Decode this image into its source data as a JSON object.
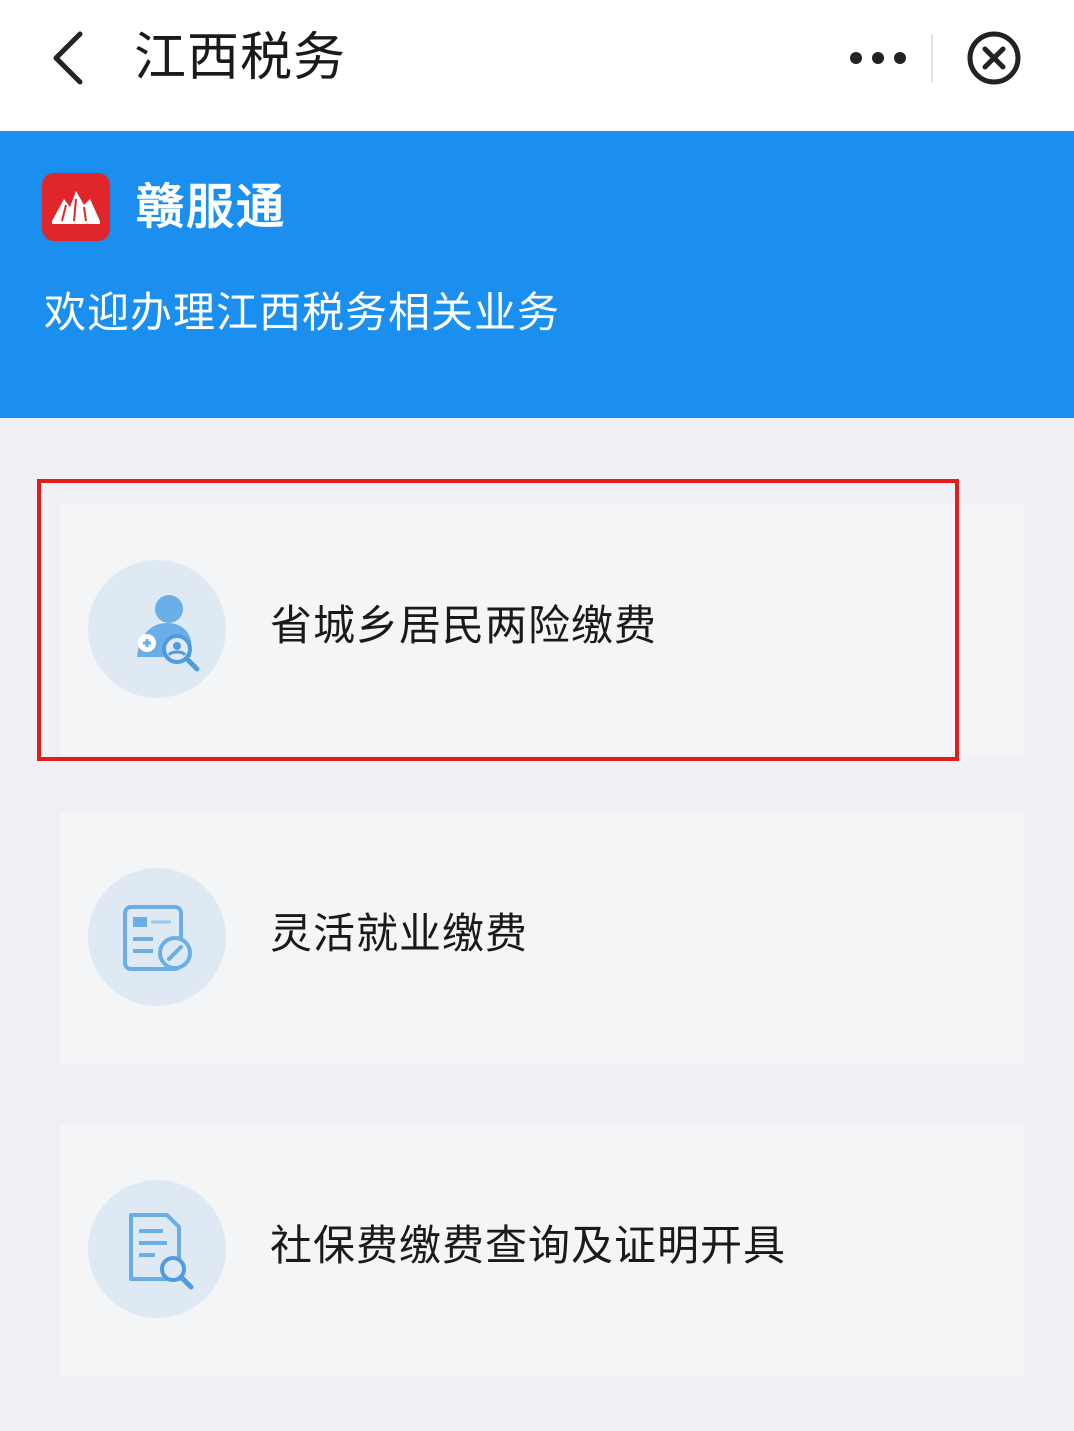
{
  "header": {
    "title": "江西税务",
    "back_icon": "chevron-left-icon",
    "more_icon": "more-dots-icon",
    "close_icon": "close-circle-icon"
  },
  "banner": {
    "brand": "赣服通",
    "welcome": "欢迎办理江西税务相关业务",
    "background_color": "#1b8ff0",
    "logo_color": "#e0262a"
  },
  "services": [
    {
      "label": "省城乡居民两险缴费",
      "icon": "resident-insurance-icon",
      "highlighted": true
    },
    {
      "label": "灵活就业缴费",
      "icon": "payment-form-icon",
      "highlighted": false
    },
    {
      "label": "社保费缴费查询及证明开具",
      "icon": "document-search-icon",
      "highlighted": false
    }
  ],
  "highlight_color": "#e21b1b"
}
